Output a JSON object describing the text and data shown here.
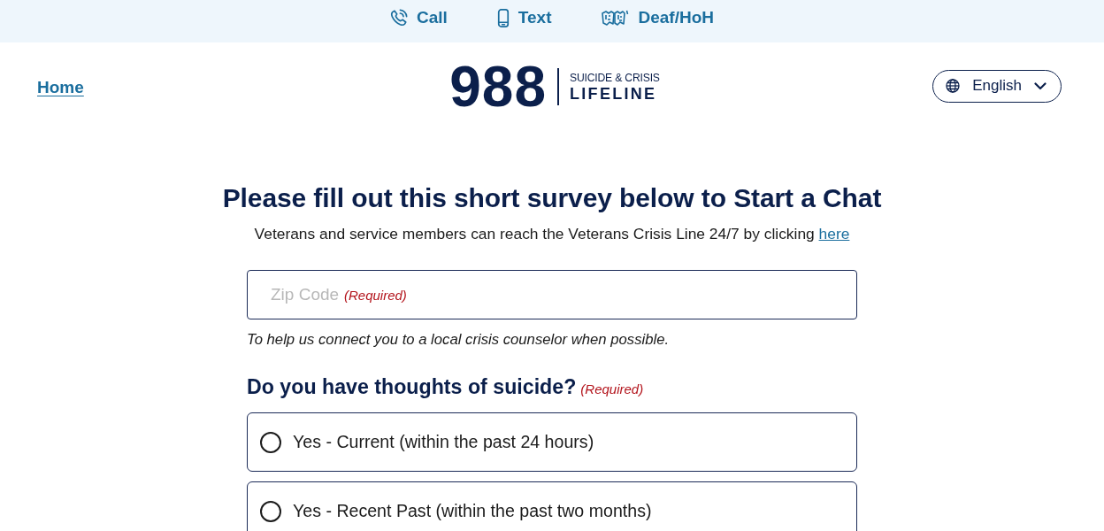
{
  "top_bar": {
    "links": [
      {
        "kind": "call",
        "label": "Call"
      },
      {
        "kind": "text",
        "label": "Text"
      },
      {
        "kind": "deaf",
        "label": "Deaf/HoH"
      }
    ]
  },
  "header": {
    "home_link": "Home",
    "logo": {
      "number": "988",
      "line1": "SUICIDE & CRISIS",
      "line2": "LIFELINE"
    },
    "language_button": "English"
  },
  "survey": {
    "title": "Please fill out this short survey below to Start a Chat",
    "veterans_note": {
      "text": "Veterans and service members can reach the Veterans Crisis Line 24/7 by clicking",
      "link": "here"
    },
    "zip_field": {
      "placeholder": "Zip Code",
      "required_label": "(Required)"
    },
    "zip_help": "To help us connect you to a local crisis counselor when possible.",
    "question": {
      "text": "Do you have thoughts of suicide?",
      "required_label": "(Required)"
    },
    "options": [
      {
        "label": "Yes - Current (within the past 24 hours)",
        "selected": false
      },
      {
        "label": "Yes - Recent Past (within the past two months)",
        "selected": false
      }
    ]
  }
}
